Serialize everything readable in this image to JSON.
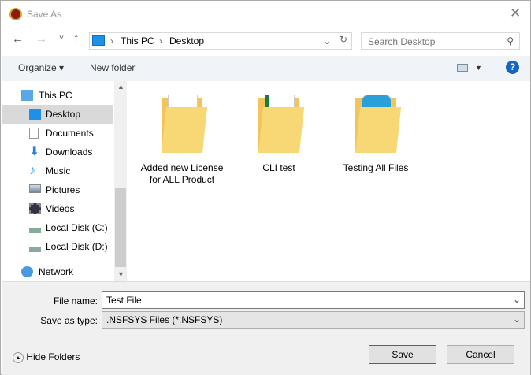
{
  "window": {
    "title": "Save As"
  },
  "address": {
    "crumbs": [
      "This PC",
      "Desktop"
    ]
  },
  "search": {
    "placeholder": "Search Desktop"
  },
  "toolbar": {
    "organize": "Organize ▾",
    "new_folder": "New folder",
    "help": "?"
  },
  "sidebar": {
    "items": [
      {
        "label": "This PC",
        "icon": "computer-icon"
      },
      {
        "label": "Desktop",
        "icon": "desktop-icon",
        "selected": true
      },
      {
        "label": "Documents",
        "icon": "documents-icon"
      },
      {
        "label": "Downloads",
        "icon": "downloads-icon"
      },
      {
        "label": "Music",
        "icon": "music-icon"
      },
      {
        "label": "Pictures",
        "icon": "pictures-icon"
      },
      {
        "label": "Videos",
        "icon": "videos-icon"
      },
      {
        "label": "Local Disk (C:)",
        "icon": "drive-icon"
      },
      {
        "label": "Local Disk (D:)",
        "icon": "drive-icon"
      },
      {
        "label": "Network",
        "icon": "network-icon"
      }
    ]
  },
  "files": [
    {
      "name": "Added new License for ALL Product"
    },
    {
      "name": "CLI test"
    },
    {
      "name": "Testing All Files"
    }
  ],
  "form": {
    "file_name_label": "File name:",
    "file_name": "Test File",
    "type_label": "Save as type:",
    "type": ".NSFSYS Files (*.NSFSYS)"
  },
  "footer": {
    "hide_folders": "Hide Folders",
    "save": "Save",
    "cancel": "Cancel"
  }
}
